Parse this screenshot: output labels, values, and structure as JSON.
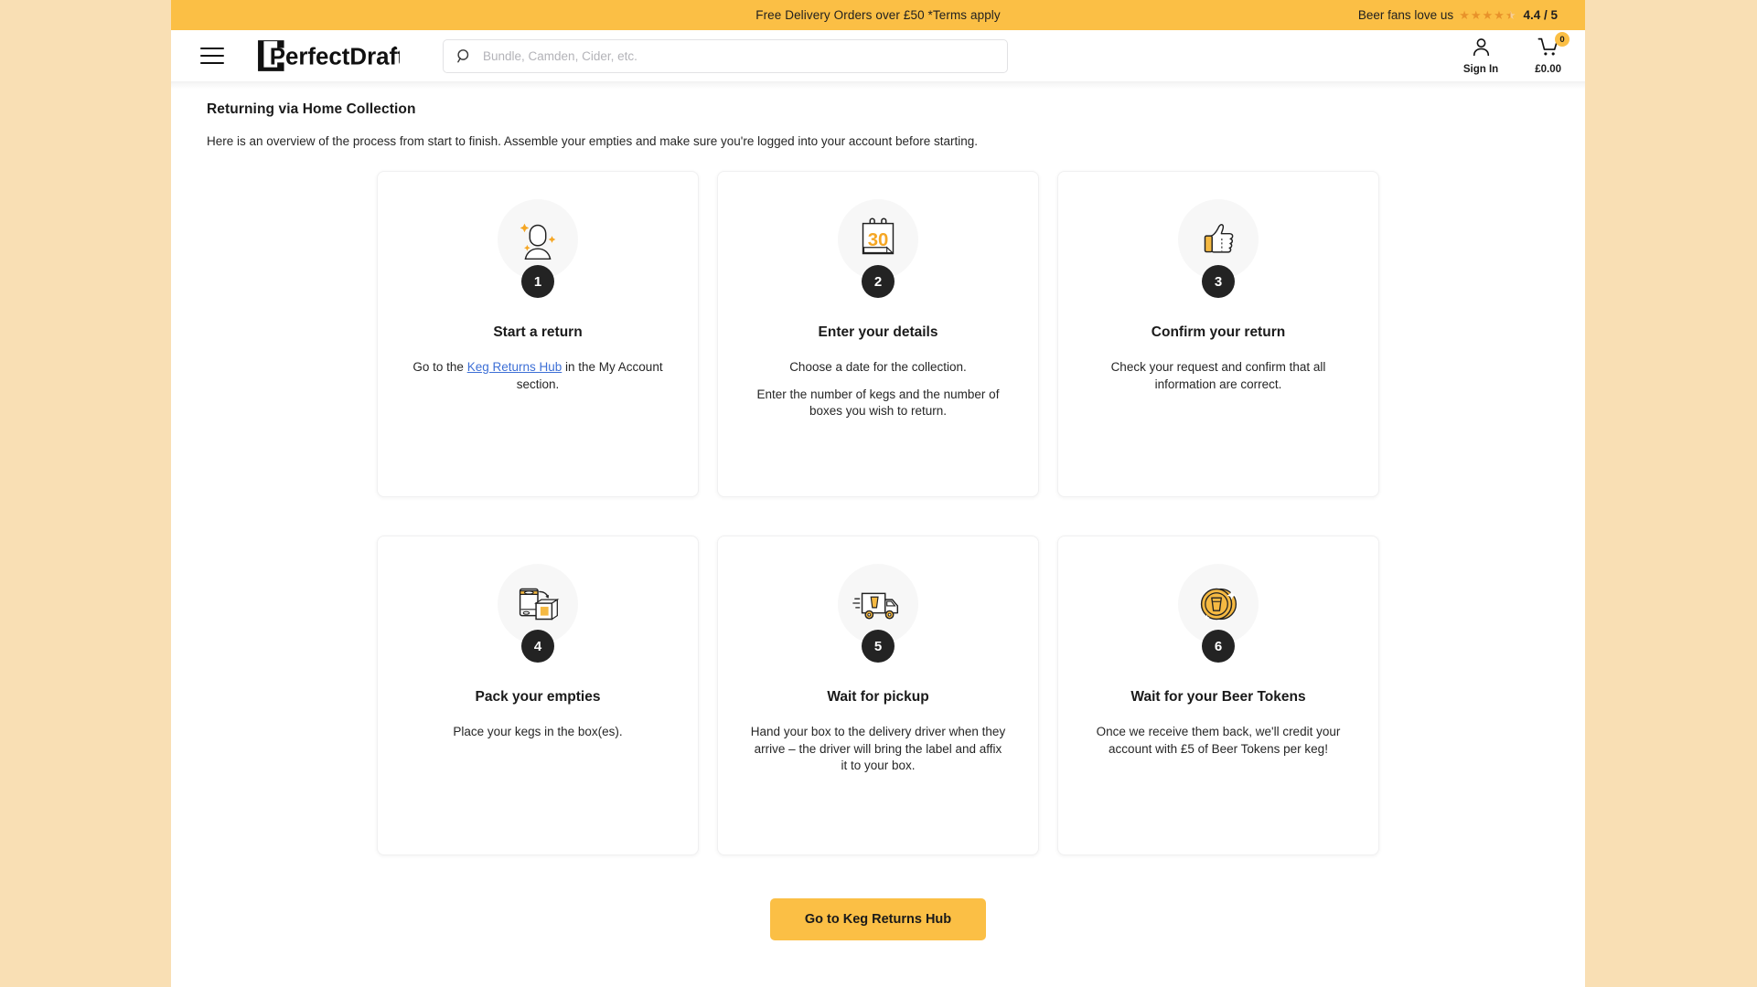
{
  "promo": {
    "message": "Free Delivery Orders over £50 *Terms apply",
    "rating_label": "Beer fans love us",
    "rating_value": "4.4 / 5",
    "stars_full": 4,
    "stars_half": 1,
    "bar_color": "#fbbf45"
  },
  "header": {
    "brand": "PerfectDraft",
    "menu_icon": "hamburger-icon",
    "search": {
      "placeholder": "Bundle, Camden, Cider, etc.",
      "value": ""
    },
    "account": {
      "label": "Sign In",
      "icon": "user-icon"
    },
    "cart": {
      "label": "£0.00",
      "count": "0",
      "icon": "cart-icon"
    }
  },
  "main": {
    "title": "Returning via Home Collection",
    "intro": "Here is an overview of the process from start to finish. Assemble your empties and make sure you're logged into your account before starting.",
    "steps": [
      {
        "number": "1",
        "icon": "sparkle-person-icon",
        "title": "Start a return",
        "body_pre": "Go to the ",
        "link": "Keg Returns Hub",
        "body_post": " in the My Account section."
      },
      {
        "number": "2",
        "icon": "calendar-30-icon",
        "title": "Enter your details",
        "body": "Choose a date for the collection.",
        "body2": "Enter the number of kegs and the number of boxes you wish to return."
      },
      {
        "number": "3",
        "icon": "thumbs-up-icon",
        "title": "Confirm your return",
        "body": "Check your request and confirm that all information are correct."
      },
      {
        "number": "4",
        "icon": "keg-into-box-icon",
        "title": "Pack your empties",
        "body": "Place your kegs in the box(es)."
      },
      {
        "number": "5",
        "icon": "delivery-truck-icon",
        "title": "Wait for pickup",
        "body": "Hand your box to the delivery driver when they arrive – the driver will bring the label and affix it to your box."
      },
      {
        "number": "6",
        "icon": "beer-token-coin-icon",
        "title": "Wait for your Beer Tokens",
        "body": "Once we receive them back, we'll credit your account with £5 of Beer Tokens per keg!"
      }
    ],
    "cta_label": "Go to Keg Returns Hub"
  },
  "colors": {
    "brand_orange": "#fbbf45",
    "page_background": "#f9dfb4",
    "badge_dark": "#232323",
    "link_blue": "#3d6fd6"
  }
}
